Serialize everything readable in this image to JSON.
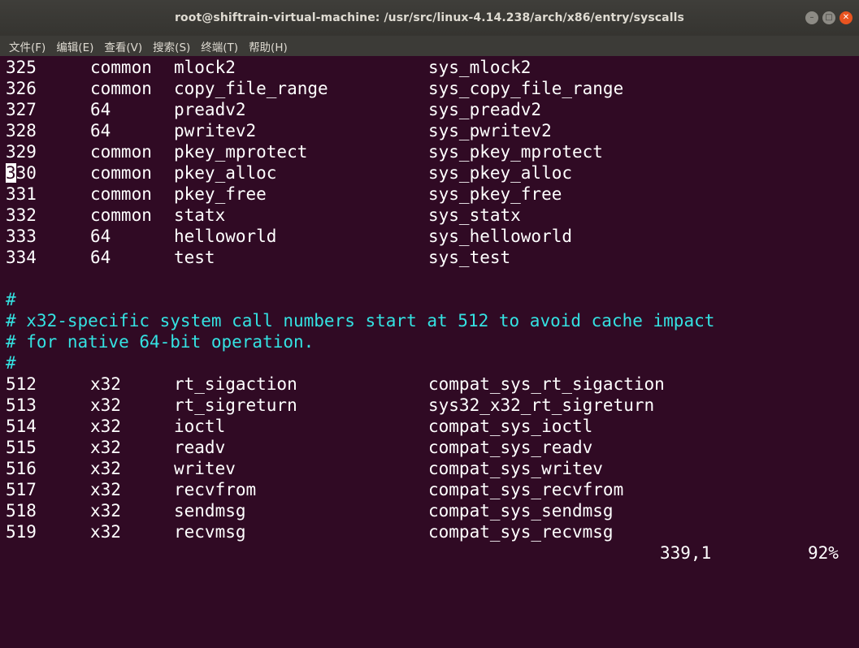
{
  "window": {
    "title": "root@shiftrain-virtual-machine: /usr/src/linux-4.14.238/arch/x86/entry/syscalls"
  },
  "menu": [
    "文件(F)",
    "编辑(E)",
    "查看(V)",
    "搜索(S)",
    "终端(T)",
    "帮助(H)"
  ],
  "rows_top": [
    {
      "num": "325",
      "abi": "common",
      "name": "mlock2",
      "entry": "sys_mlock2"
    },
    {
      "num": "326",
      "abi": "common",
      "name": "copy_file_range",
      "entry": "sys_copy_file_range"
    },
    {
      "num": "327",
      "abi": "64",
      "name": "preadv2",
      "entry": "sys_preadv2"
    },
    {
      "num": "328",
      "abi": "64",
      "name": "pwritev2",
      "entry": "sys_pwritev2"
    },
    {
      "num": "329",
      "abi": "common",
      "name": "pkey_mprotect",
      "entry": "sys_pkey_mprotect"
    },
    {
      "num_cursor": "3",
      "num_rest": "30",
      "abi": "common",
      "name": "pkey_alloc",
      "entry": "sys_pkey_alloc"
    },
    {
      "num": "331",
      "abi": "common",
      "name": "pkey_free",
      "entry": "sys_pkey_free"
    },
    {
      "num": "332",
      "abi": "common",
      "name": "statx",
      "entry": "sys_statx"
    },
    {
      "num": "333",
      "abi": "64",
      "name": "helloworld",
      "entry": "sys_helloworld"
    },
    {
      "num": "334",
      "abi": "64",
      "name": "test",
      "entry": "sys_test"
    }
  ],
  "comments": [
    "#",
    "# x32-specific system call numbers start at 512 to avoid cache impact",
    "# for native 64-bit operation.",
    "#"
  ],
  "rows_bottom": [
    {
      "num": "512",
      "abi": "x32",
      "name": "rt_sigaction",
      "entry": "compat_sys_rt_sigaction"
    },
    {
      "num": "513",
      "abi": "x32",
      "name": "rt_sigreturn",
      "entry": "sys32_x32_rt_sigreturn"
    },
    {
      "num": "514",
      "abi": "x32",
      "name": "ioctl",
      "entry": "compat_sys_ioctl"
    },
    {
      "num": "515",
      "abi": "x32",
      "name": "readv",
      "entry": "compat_sys_readv"
    },
    {
      "num": "516",
      "abi": "x32",
      "name": "writev",
      "entry": "compat_sys_writev"
    },
    {
      "num": "517",
      "abi": "x32",
      "name": "recvfrom",
      "entry": "compat_sys_recvfrom"
    },
    {
      "num": "518",
      "abi": "x32",
      "name": "sendmsg",
      "entry": "compat_sys_sendmsg"
    },
    {
      "num": "519",
      "abi": "x32",
      "name": "recvmsg",
      "entry": "compat_sys_recvmsg"
    }
  ],
  "status": {
    "position": "339,1",
    "percent": "92%"
  },
  "colors": {
    "background": "#300a24",
    "text": "#ffffff",
    "comment": "#34e2e2",
    "close_button": "#e95420"
  }
}
